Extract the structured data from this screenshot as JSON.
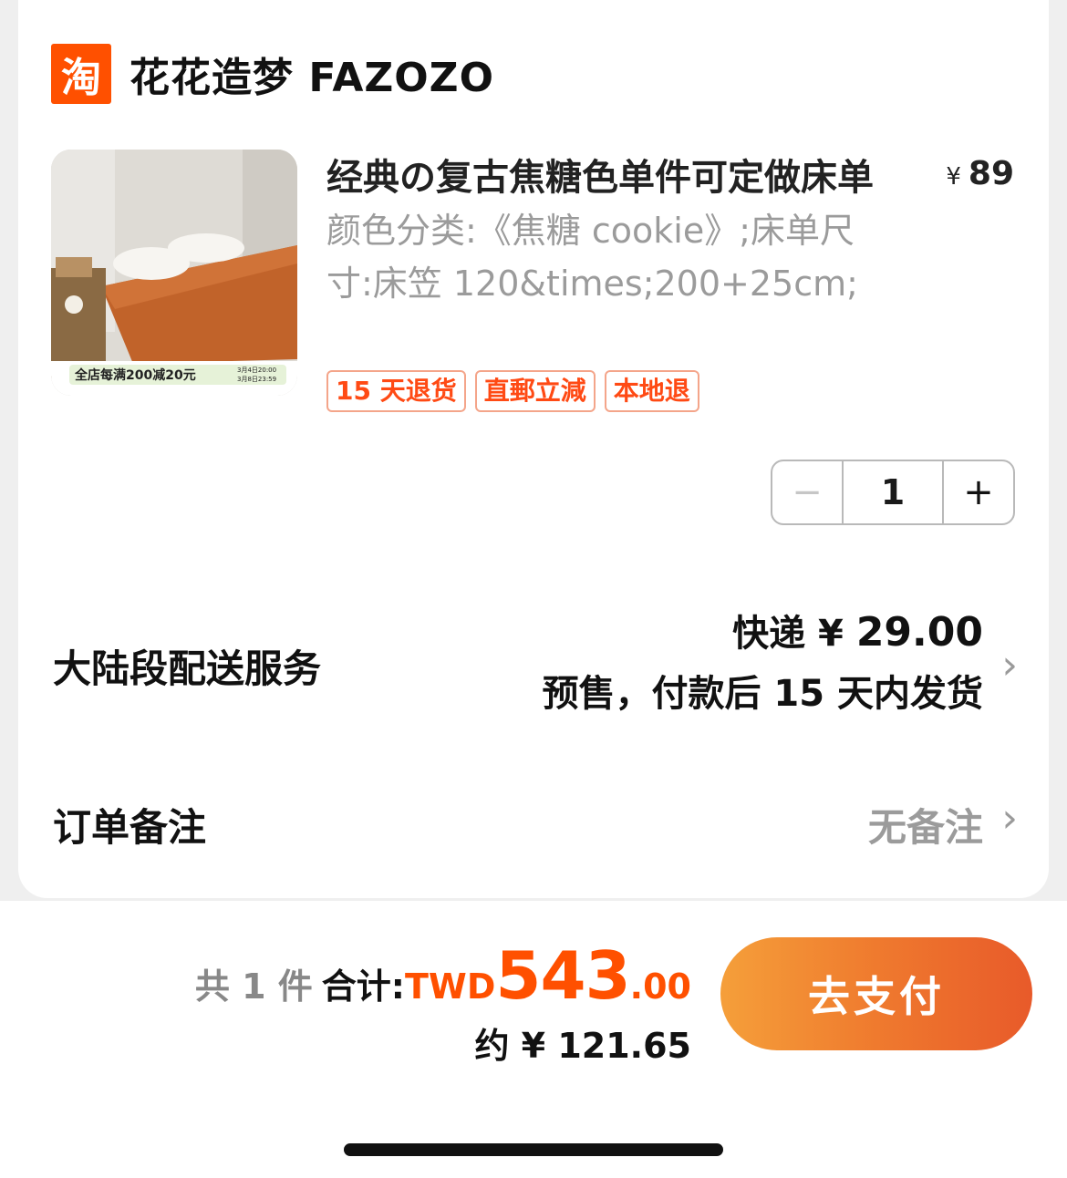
{
  "shop": {
    "logo_char": "淘",
    "name": "花花造梦 FAZOZO"
  },
  "product": {
    "title": "经典の复古焦糖色单件可定做床单",
    "price_symbol": "¥",
    "price": "89",
    "variant": "颜色分类:《焦糖 cookie》;床单尺寸:床笠 120&times;200+25cm;",
    "image_banner": "全店每满200减20元",
    "image_dates": [
      "3月4日20:00",
      "3月8日23:59"
    ],
    "tags": [
      "15 天退货",
      "直郵立減",
      "本地退"
    ],
    "quantity": "1",
    "minus_label": "−",
    "plus_label": "+"
  },
  "shipping": {
    "label": "大陆段配送服务",
    "fee_prefix": "快递 ¥ ",
    "fee": "29.00",
    "presale": "预售，付款后 15 天内发货",
    "chevron": "›"
  },
  "note": {
    "label": "订单备注",
    "value": "无备注",
    "chevron": "›"
  },
  "footer": {
    "count_prefix": "共",
    "count": "1",
    "count_suffix": "件",
    "total_label": "合计:",
    "currency": "TWD",
    "total_int": "543",
    "total_dec": ".00",
    "approx": "约 ¥ 121.65",
    "pay_label": "去支付"
  },
  "colors": {
    "accent": "#ff5000",
    "pay_gradient_start": "#f59f3a",
    "pay_gradient_end": "#e85a2a"
  }
}
